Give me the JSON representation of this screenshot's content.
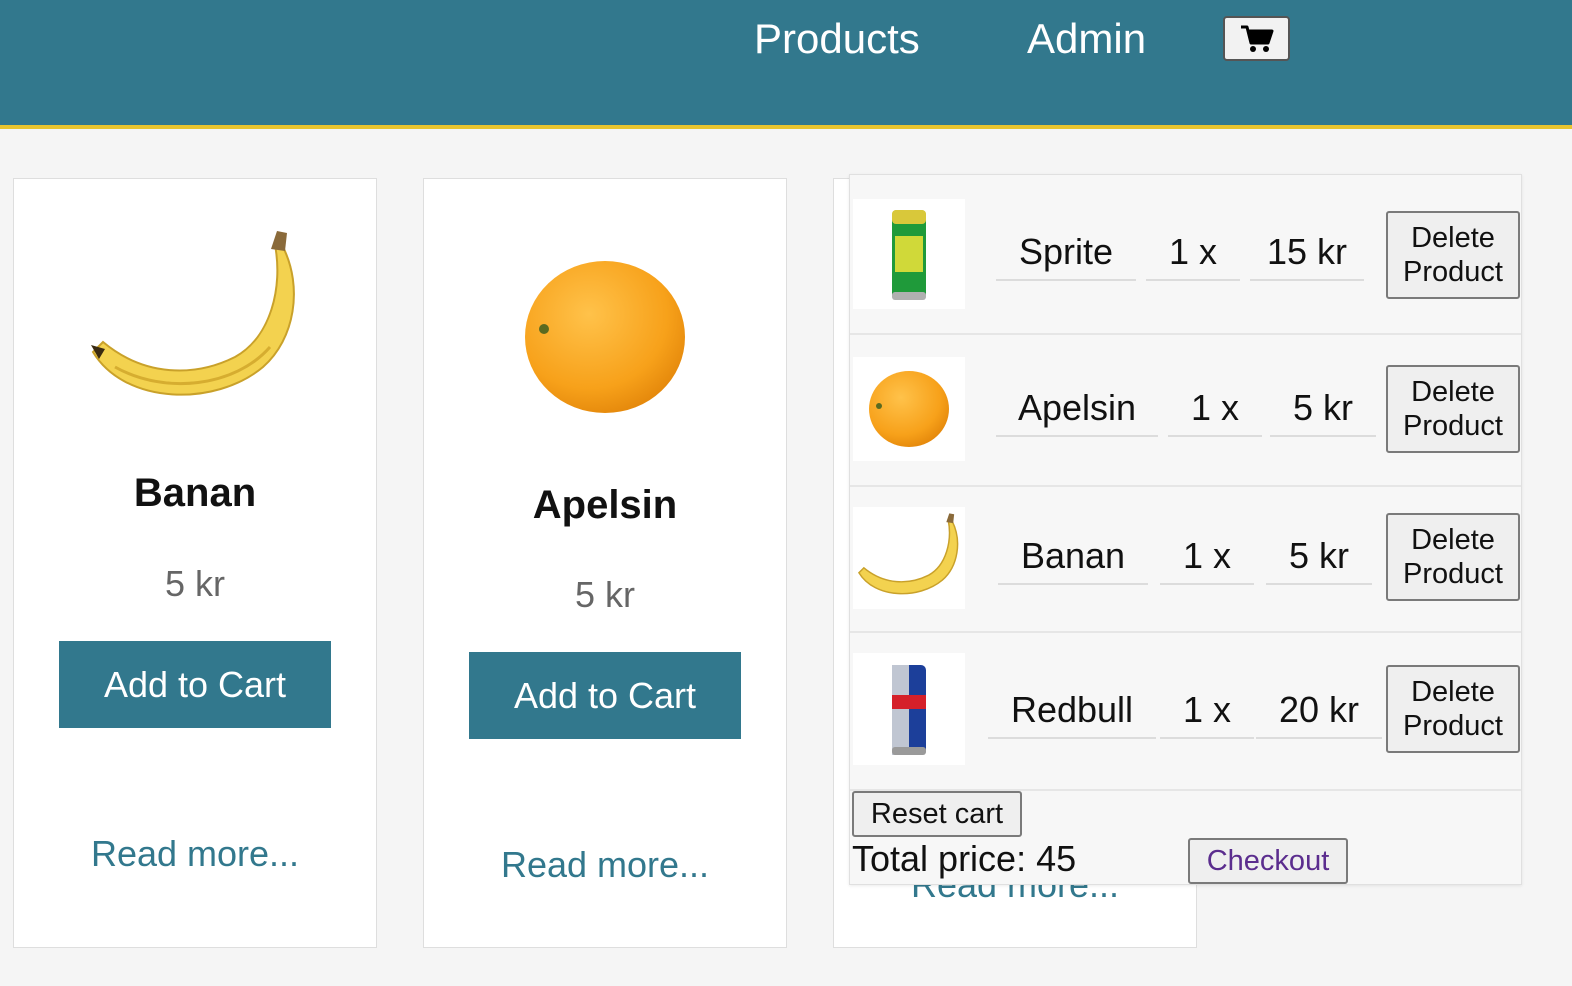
{
  "nav": {
    "products_label": "Products",
    "admin_label": "Admin",
    "cart_icon": "shopping-cart-icon"
  },
  "colors": {
    "header_bg": "#32788d",
    "header_accent": "#e8c42e",
    "button_bg": "#32788d",
    "link_color": "#32788d",
    "checkout_text": "#5b2d8e"
  },
  "products": [
    {
      "name": "Banan",
      "price": "5 kr",
      "add_label": "Add to Cart",
      "read_more": "Read more...",
      "image": "banana"
    },
    {
      "name": "Apelsin",
      "price": "5 kr",
      "add_label": "Add to Cart",
      "read_more": "Read more...",
      "image": "orange"
    },
    {
      "read_more": "Read more..."
    }
  ],
  "cart": {
    "items": [
      {
        "name": "Sprite",
        "qty": "1 x",
        "price": "15 kr",
        "delete_label": "Delete Product",
        "image": "sprite-can"
      },
      {
        "name": "Apelsin",
        "qty": "1 x",
        "price": "5 kr",
        "delete_label": "Delete Product",
        "image": "orange"
      },
      {
        "name": "Banan",
        "qty": "1 x",
        "price": "5 kr",
        "delete_label": "Delete Product",
        "image": "banana"
      },
      {
        "name": "Redbull",
        "qty": "1 x",
        "price": "20 kr",
        "delete_label": "Delete Product",
        "image": "redbull-can"
      }
    ],
    "reset_label": "Reset cart",
    "total_label": "Total price: 45",
    "checkout_label": "Checkout"
  }
}
